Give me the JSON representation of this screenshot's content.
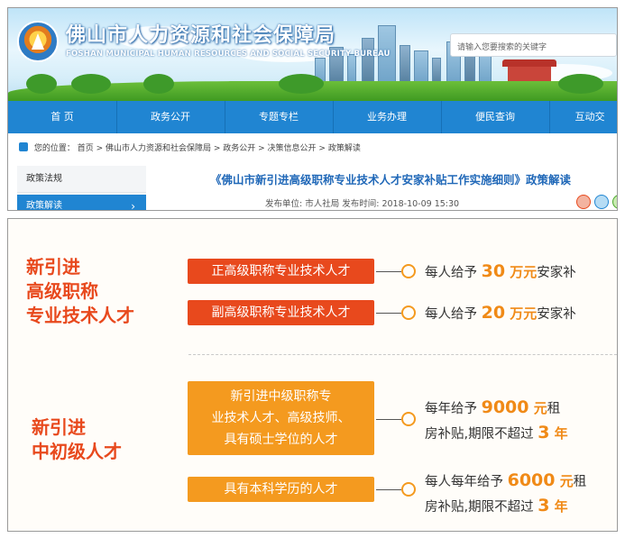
{
  "header": {
    "title": "佛山市人力资源和社会保障局",
    "subtitle": "FOSHAN MUNICIPAL HUMAN RESOURCES AND SOCIAL SECURITY BUREAU",
    "search_placeholder": "请输入您要搜索的关键字"
  },
  "nav": {
    "items": [
      "首  页",
      "政务公开",
      "专题专栏",
      "业务办理",
      "便民查询",
      "互动交"
    ]
  },
  "breadcrumb": {
    "prefix": "您的位置：",
    "path": "首页 > 佛山市人力资源和社会保障局 > 政务公开 > 决策信息公开 > 政策解读"
  },
  "sidebar": {
    "items": [
      "政策法规",
      "政策解读"
    ],
    "arrow": "›"
  },
  "article": {
    "title": "《佛山市新引进高级职称专业技术人才安家补贴工作实施细则》政策解读",
    "meta": "发布单位:  市人社局     发布时间:  2018-10-09 15:30"
  },
  "colors": {
    "nav_blue": "#2085d2",
    "title_blue": "#2068b8",
    "red_orange": "#e8491d",
    "orange": "#f49a1f",
    "amount_orange": "#f08a17"
  },
  "infographic": {
    "section1": {
      "title_lines": [
        "新引进",
        "高级职称",
        "专业技术人才"
      ],
      "rows": [
        {
          "label": "正高级职称专业技术人才",
          "pre": "每人给予 ",
          "amount": "30",
          "unit": " 万元",
          "post": "安家补"
        },
        {
          "label": "副高级职称专业技术人才",
          "pre": "每人给予 ",
          "amount": "20",
          "unit": " 万元",
          "post": "安家补"
        }
      ]
    },
    "section2": {
      "title_lines": [
        "新引进",
        "中初级人才"
      ],
      "rows": [
        {
          "label_lines": [
            "新引进中级职称专",
            "业技术人才、高级技师、",
            "具有硕士学位的人才"
          ],
          "line1_pre": "每年给予 ",
          "line1_amount": "9000",
          "line1_unit": " 元",
          "line1_post": "租",
          "line2_pre": "房补贴,期限不超过 ",
          "line2_amount": "3",
          "line2_unit": " 年"
        },
        {
          "label": "具有本科学历的人才",
          "line1_pre": "每人每年给予 ",
          "line1_amount": "6000",
          "line1_unit": " 元",
          "line1_post": "租",
          "line2_pre": "房补贴,期限不超过 ",
          "line2_amount": "3",
          "line2_unit": " 年"
        }
      ]
    }
  }
}
